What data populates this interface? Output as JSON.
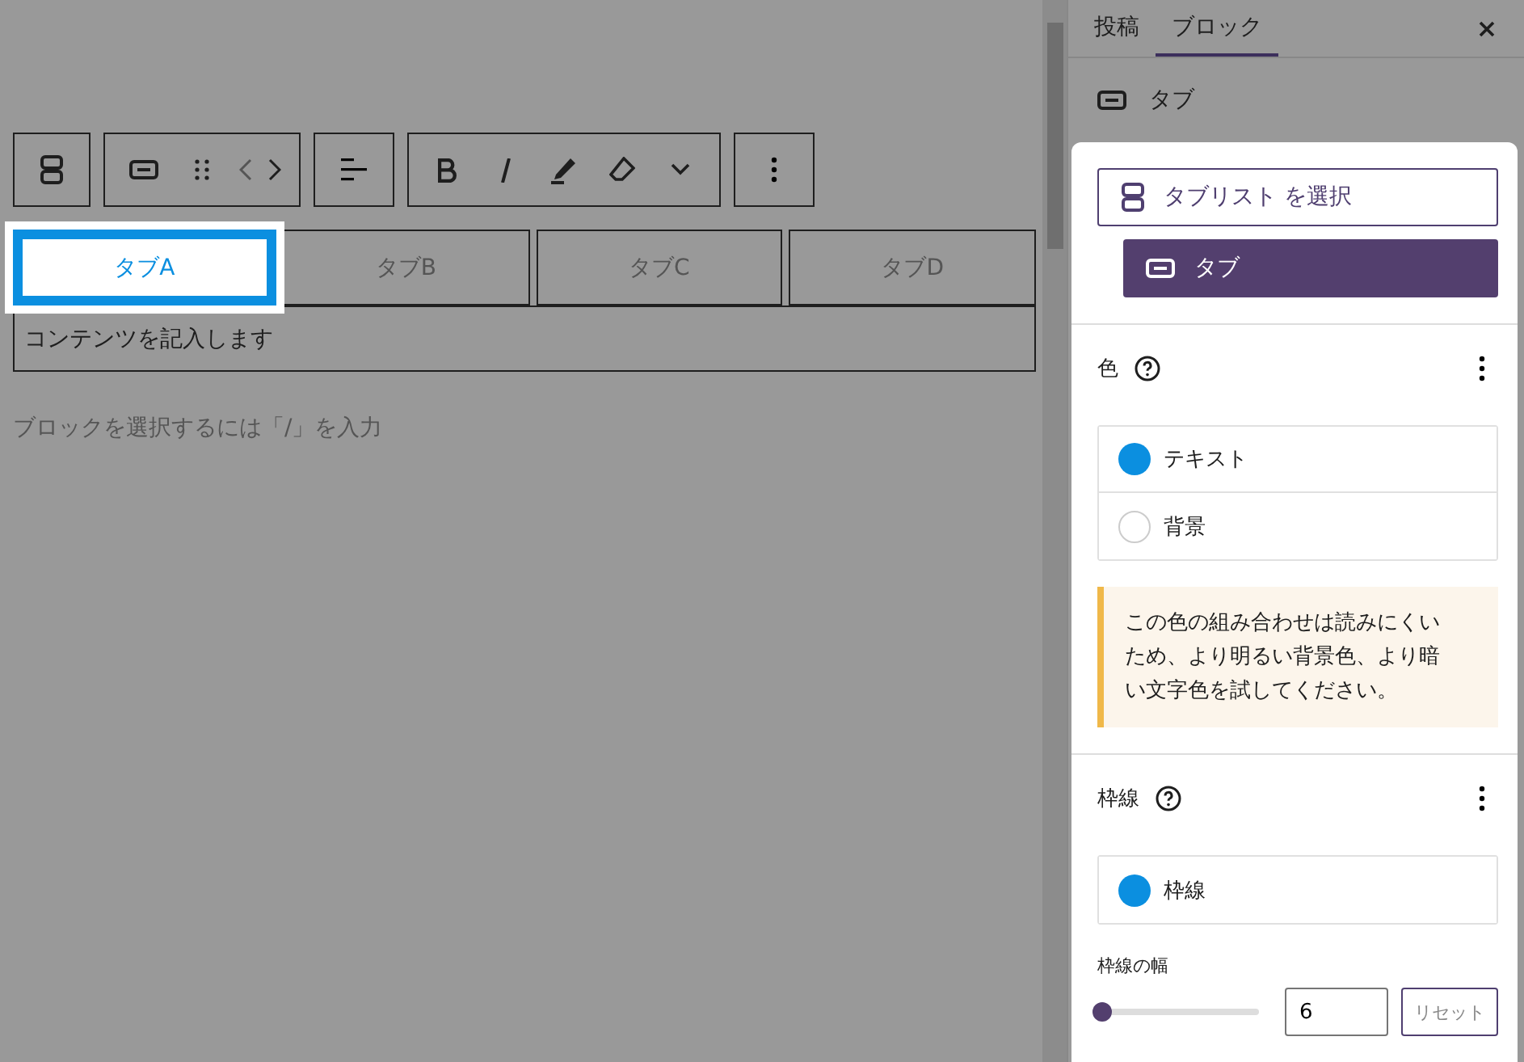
{
  "editor": {
    "tabs": [
      {
        "label": "タブA",
        "selected": true
      },
      {
        "label": "タブB",
        "selected": false
      },
      {
        "label": "タブC",
        "selected": false
      },
      {
        "label": "タブD",
        "selected": false
      }
    ],
    "content": "コンテンツを記入します",
    "hint": "ブロックを選択するには「/」を入力"
  },
  "sidebar": {
    "tabs": [
      {
        "label": "投稿",
        "selected": false
      },
      {
        "label": "ブロック",
        "selected": true
      }
    ],
    "block_title": "タブ",
    "popover": {
      "parent_button": "タブリスト を選択",
      "current_block": "タブ",
      "color_section": {
        "title": "色",
        "items": [
          {
            "label": "テキスト",
            "color": "#0b8fe0"
          },
          {
            "label": "背景"
          }
        ],
        "warning": "この色の組み合わせは読みにくいため、より明るい背景色、より暗い文字色を試してください。"
      },
      "border_section": {
        "title": "枠線",
        "items": [
          {
            "label": "枠線",
            "color": "#0b8fe0"
          }
        ],
        "width_label": "枠線の幅",
        "width_slider": {
          "level": 0.03
        },
        "width_value": "6",
        "reset": "リセット"
      }
    }
  }
}
